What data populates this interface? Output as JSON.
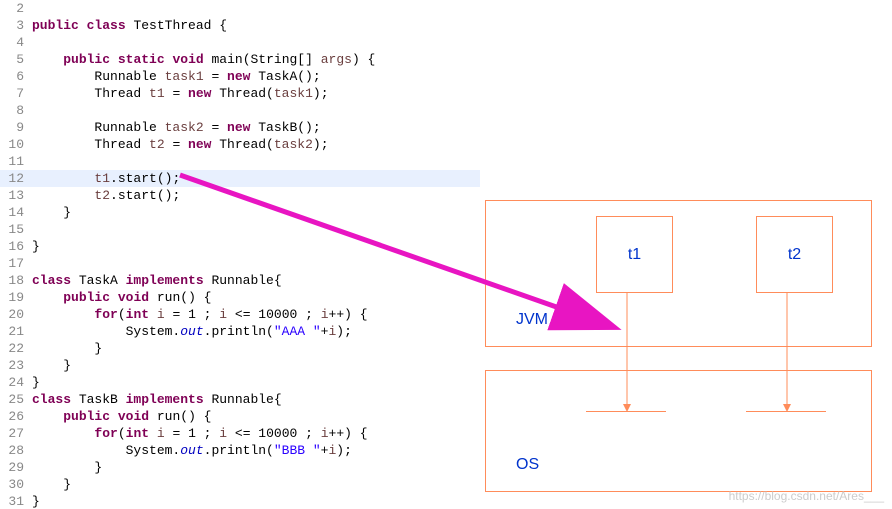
{
  "code": {
    "lines": [
      {
        "n": "2",
        "cls": "",
        "segs": []
      },
      {
        "n": "3",
        "cls": "",
        "segs": [
          {
            "t": "public",
            "c": "kw"
          },
          {
            "t": " "
          },
          {
            "t": "class",
            "c": "kw"
          },
          {
            "t": " TestThread {"
          }
        ]
      },
      {
        "n": "4",
        "cls": "",
        "segs": []
      },
      {
        "n": "5",
        "cls": "",
        "segs": [
          {
            "t": "    "
          },
          {
            "t": "public",
            "c": "kw"
          },
          {
            "t": " "
          },
          {
            "t": "static",
            "c": "kw"
          },
          {
            "t": " "
          },
          {
            "t": "void",
            "c": "kw"
          },
          {
            "t": " main(String[] "
          },
          {
            "t": "args",
            "c": "param"
          },
          {
            "t": ") {"
          }
        ]
      },
      {
        "n": "6",
        "cls": "",
        "segs": [
          {
            "t": "        Runnable "
          },
          {
            "t": "task1",
            "c": "param"
          },
          {
            "t": " = "
          },
          {
            "t": "new",
            "c": "kw"
          },
          {
            "t": " TaskA();"
          }
        ]
      },
      {
        "n": "7",
        "cls": "",
        "segs": [
          {
            "t": "        Thread "
          },
          {
            "t": "t1",
            "c": "param"
          },
          {
            "t": " = "
          },
          {
            "t": "new",
            "c": "kw"
          },
          {
            "t": " Thread("
          },
          {
            "t": "task1",
            "c": "param"
          },
          {
            "t": ");"
          }
        ]
      },
      {
        "n": "8",
        "cls": "",
        "segs": []
      },
      {
        "n": "9",
        "cls": "",
        "segs": [
          {
            "t": "        Runnable "
          },
          {
            "t": "task2",
            "c": "param"
          },
          {
            "t": " = "
          },
          {
            "t": "new",
            "c": "kw"
          },
          {
            "t": " TaskB();"
          }
        ]
      },
      {
        "n": "10",
        "cls": "",
        "segs": [
          {
            "t": "        Thread "
          },
          {
            "t": "t2",
            "c": "param"
          },
          {
            "t": " = "
          },
          {
            "t": "new",
            "c": "kw"
          },
          {
            "t": " Thread("
          },
          {
            "t": "task2",
            "c": "param"
          },
          {
            "t": ");"
          }
        ]
      },
      {
        "n": "11",
        "cls": "",
        "segs": []
      },
      {
        "n": "12",
        "cls": "hl",
        "segs": [
          {
            "t": "        "
          },
          {
            "t": "t1",
            "c": "param"
          },
          {
            "t": ".start();"
          }
        ]
      },
      {
        "n": "13",
        "cls": "",
        "segs": [
          {
            "t": "        "
          },
          {
            "t": "t2",
            "c": "param"
          },
          {
            "t": ".start();"
          }
        ]
      },
      {
        "n": "14",
        "cls": "",
        "segs": [
          {
            "t": "    }"
          }
        ]
      },
      {
        "n": "15",
        "cls": "",
        "segs": []
      },
      {
        "n": "16",
        "cls": "",
        "segs": [
          {
            "t": "}"
          }
        ]
      },
      {
        "n": "17",
        "cls": "",
        "segs": []
      },
      {
        "n": "18",
        "cls": "",
        "segs": [
          {
            "t": "class",
            "c": "kw"
          },
          {
            "t": " TaskA "
          },
          {
            "t": "implements",
            "c": "kw"
          },
          {
            "t": " Runnable{"
          }
        ]
      },
      {
        "n": "19",
        "cls": "",
        "segs": [
          {
            "t": "    "
          },
          {
            "t": "public",
            "c": "kw"
          },
          {
            "t": " "
          },
          {
            "t": "void",
            "c": "kw"
          },
          {
            "t": " run() {"
          }
        ]
      },
      {
        "n": "20",
        "cls": "",
        "segs": [
          {
            "t": "        "
          },
          {
            "t": "for",
            "c": "kw"
          },
          {
            "t": "("
          },
          {
            "t": "int",
            "c": "kw"
          },
          {
            "t": " "
          },
          {
            "t": "i",
            "c": "param"
          },
          {
            "t": " = 1 ; "
          },
          {
            "t": "i",
            "c": "param"
          },
          {
            "t": " <= 10000 ; "
          },
          {
            "t": "i",
            "c": "param"
          },
          {
            "t": "++) {"
          }
        ]
      },
      {
        "n": "21",
        "cls": "",
        "segs": [
          {
            "t": "            System."
          },
          {
            "t": "out",
            "c": "field"
          },
          {
            "t": ".println("
          },
          {
            "t": "\"AAA \"",
            "c": "str"
          },
          {
            "t": "+"
          },
          {
            "t": "i",
            "c": "param"
          },
          {
            "t": ");"
          }
        ]
      },
      {
        "n": "22",
        "cls": "",
        "segs": [
          {
            "t": "        }"
          }
        ]
      },
      {
        "n": "23",
        "cls": "",
        "segs": [
          {
            "t": "    }"
          }
        ]
      },
      {
        "n": "24",
        "cls": "",
        "segs": [
          {
            "t": "}"
          }
        ]
      },
      {
        "n": "25",
        "cls": "",
        "segs": [
          {
            "t": "class",
            "c": "kw"
          },
          {
            "t": " TaskB "
          },
          {
            "t": "implements",
            "c": "kw"
          },
          {
            "t": " Runnable{"
          }
        ]
      },
      {
        "n": "26",
        "cls": "",
        "segs": [
          {
            "t": "    "
          },
          {
            "t": "public",
            "c": "kw"
          },
          {
            "t": " "
          },
          {
            "t": "void",
            "c": "kw"
          },
          {
            "t": " run() {"
          }
        ]
      },
      {
        "n": "27",
        "cls": "",
        "segs": [
          {
            "t": "        "
          },
          {
            "t": "for",
            "c": "kw"
          },
          {
            "t": "("
          },
          {
            "t": "int",
            "c": "kw"
          },
          {
            "t": " "
          },
          {
            "t": "i",
            "c": "param"
          },
          {
            "t": " = 1 ; "
          },
          {
            "t": "i",
            "c": "param"
          },
          {
            "t": " <= 10000 ; "
          },
          {
            "t": "i",
            "c": "param"
          },
          {
            "t": "++) {"
          }
        ]
      },
      {
        "n": "28",
        "cls": "",
        "segs": [
          {
            "t": "            System."
          },
          {
            "t": "out",
            "c": "field"
          },
          {
            "t": ".println("
          },
          {
            "t": "\"BBB \"",
            "c": "str"
          },
          {
            "t": "+"
          },
          {
            "t": "i",
            "c": "param"
          },
          {
            "t": ");"
          }
        ]
      },
      {
        "n": "29",
        "cls": "",
        "segs": [
          {
            "t": "        }"
          }
        ]
      },
      {
        "n": "30",
        "cls": "",
        "segs": [
          {
            "t": "    }"
          }
        ]
      },
      {
        "n": "31",
        "cls": "",
        "segs": [
          {
            "t": "}"
          }
        ]
      }
    ]
  },
  "diagram": {
    "jvm_label": "JVM",
    "os_label": "OS",
    "t1_label": "t1",
    "t2_label": "t2"
  },
  "watermark": "https://blog.csdn.net/Ares___"
}
